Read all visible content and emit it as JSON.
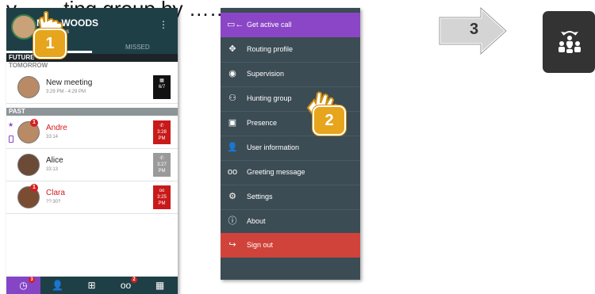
{
  "caption": "y… …ting group by …… ,",
  "left_phone": {
    "user_name": "Marc WOODS",
    "user_sub": "devices",
    "tab_missed": "MISSED",
    "kebab": "⋮",
    "sections": {
      "future": "FUTURE",
      "tomorrow": "TOMORROW",
      "past": "PAST"
    },
    "meeting": {
      "title": "New meeting",
      "time": "3:29 PM - 4:29 PM",
      "date_box": "6/7"
    },
    "calls": [
      {
        "name": "Andre",
        "sub": "33:14",
        "time": "3:28 PM",
        "badge": "1"
      },
      {
        "name": "Alice",
        "sub": "33:13",
        "time": "3:27 PM"
      },
      {
        "name": "Clara",
        "sub": "??:30?",
        "time": "3:25 PM",
        "badge": "1"
      }
    ],
    "bottom_nav": [
      {
        "icon": "history-icon",
        "glyph": "◷",
        "badge": "3"
      },
      {
        "icon": "contacts-icon",
        "glyph": "👤"
      },
      {
        "icon": "dialpad-icon",
        "glyph": "⊞"
      },
      {
        "icon": "voicemail-icon",
        "glyph": "oo",
        "badge": "2"
      },
      {
        "icon": "calendar-icon",
        "glyph": "▦"
      }
    ]
  },
  "callouts": {
    "one": "1",
    "two": "2",
    "three": "3"
  },
  "menu": {
    "items": [
      {
        "label": "Get active call",
        "icon": "active-call-icon",
        "glyph": "▭←"
      },
      {
        "label": "Routing profile",
        "icon": "routing-icon",
        "glyph": "✥"
      },
      {
        "label": "Supervision",
        "icon": "eye-icon",
        "glyph": "◉"
      },
      {
        "label": "Hunting group",
        "icon": "hunting-group-icon",
        "glyph": "⚇"
      },
      {
        "label": "Presence",
        "icon": "presence-icon",
        "glyph": "▣"
      },
      {
        "label": "User information",
        "icon": "user-icon",
        "glyph": "👤"
      },
      {
        "label": "Greeting message",
        "icon": "voicemail-icon",
        "glyph": "oo"
      },
      {
        "label": "Settings",
        "icon": "gear-icon",
        "glyph": "⚙"
      },
      {
        "label": "About",
        "icon": "info-icon",
        "glyph": "ⓘ"
      },
      {
        "label": "Sign out",
        "icon": "sign-out-icon",
        "glyph": "↪"
      }
    ]
  },
  "colors": {
    "header": "#1f3f47",
    "accent_purple": "#8a46c7",
    "sign_out_red": "#d0433a",
    "menu_bg": "#3c4c54",
    "callout_gold": "#e6a51d"
  }
}
